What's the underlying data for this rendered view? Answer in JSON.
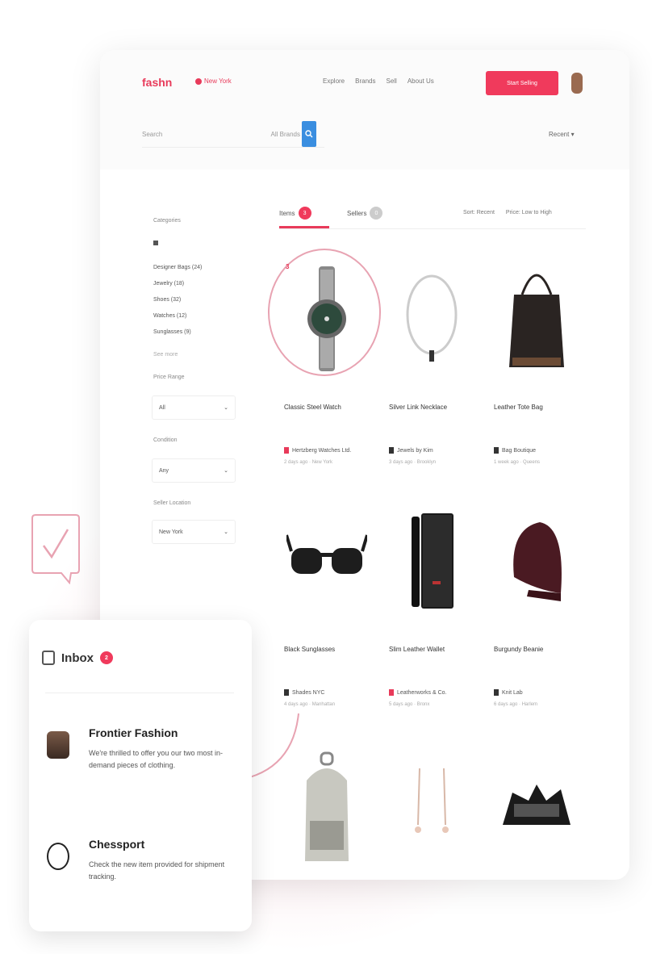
{
  "colors": {
    "accent": "#e83a5a",
    "button": "#f03a5c",
    "blue": "#3a8ee0"
  },
  "header": {
    "logo": "fashn",
    "location": "New York",
    "nav": [
      "Explore",
      "Brands",
      "Sell",
      "About Us"
    ],
    "cta": "Start Selling",
    "search_placeholder": "Search",
    "search_category": "All Brands",
    "sort_select": "Recent"
  },
  "sidebar": {
    "filter_label": "Categories",
    "items": [
      "Designer Bags (24)",
      "Jewelry (18)",
      "Shoes (32)",
      "Watches (12)",
      "Sunglasses (9)"
    ],
    "more": "See more",
    "price_label": "Price Range",
    "price_value": "All",
    "condition_label": "Condition",
    "condition_value": "Any",
    "location_label": "Seller Location",
    "location_value": "New York"
  },
  "tabs": [
    {
      "label": "Items",
      "count": "3"
    },
    {
      "label": "Sellers",
      "count": "0"
    }
  ],
  "sort": [
    "Sort: Recent",
    "Price: Low to High"
  ],
  "circled_number": "3",
  "products": [
    {
      "name": "Classic Steel Watch",
      "seller": "Hertzberg Watches Ltd.",
      "sub": "2 days ago · New York"
    },
    {
      "name": "Silver Link Necklace",
      "seller": "Jewels by Kim",
      "sub": "3 days ago · Brooklyn"
    },
    {
      "name": "Leather Tote Bag",
      "seller": "Bag Boutique",
      "sub": "1 week ago · Queens"
    },
    {
      "name": "Black Sunglasses",
      "seller": "Shades NYC",
      "sub": "4 days ago · Manhattan"
    },
    {
      "name": "Slim Leather Wallet",
      "seller": "Leatherworks & Co.",
      "sub": "5 days ago · Bronx"
    },
    {
      "name": "Burgundy Beanie",
      "seller": "Knit Lab",
      "sub": "6 days ago · Harlem"
    },
    {
      "name": "",
      "seller": "",
      "sub": ""
    },
    {
      "name": "",
      "seller": "",
      "sub": ""
    },
    {
      "name": "",
      "seller": "",
      "sub": ""
    }
  ],
  "inbox": {
    "title": "Inbox",
    "count": "2",
    "messages": [
      {
        "name": "Frontier Fashion",
        "text": "We're thrilled to offer you our two most in-demand pieces of clothing."
      },
      {
        "name": "Chessport",
        "text": "Check the new item provided for shipment tracking."
      }
    ]
  }
}
